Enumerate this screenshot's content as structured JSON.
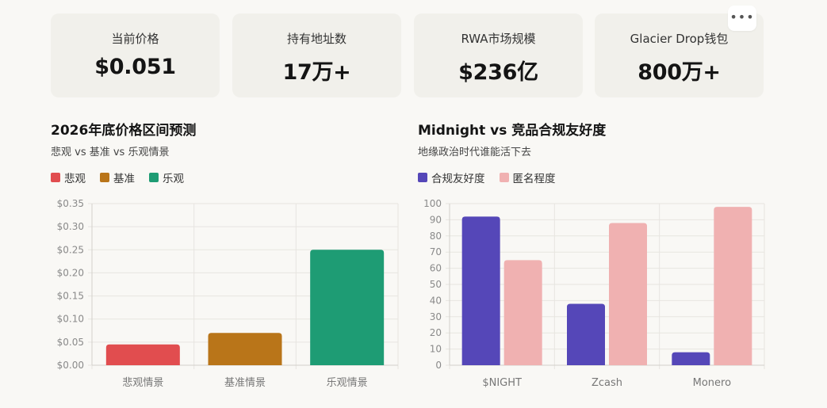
{
  "stats": [
    {
      "label": "当前价格",
      "value": "$0.051"
    },
    {
      "label": "持有地址数",
      "value": "17万+"
    },
    {
      "label": "RWA市场规模",
      "value": "$236亿"
    },
    {
      "label": "Glacier Drop钱包",
      "value": "800万+"
    }
  ],
  "more_button": "•••",
  "chart_data": [
    {
      "type": "bar",
      "title": "2026年底价格区间预测",
      "subtitle": "悲观 vs 基准 vs 乐观情景",
      "legend": [
        "悲观",
        "基准",
        "乐观"
      ],
      "categories": [
        "悲观情景",
        "基准情景",
        "乐观情景"
      ],
      "values": [
        0.045,
        0.07,
        0.25
      ],
      "colors": [
        "#e14d4f",
        "#b97519",
        "#1e9c74"
      ],
      "ylim": [
        0,
        0.35
      ],
      "yticks": [
        "$0.00",
        "$0.05",
        "$0.10",
        "$0.15",
        "$0.20",
        "$0.25",
        "$0.30",
        "$0.35"
      ],
      "grid": true,
      "legend_position": "top-left"
    },
    {
      "type": "bar",
      "title": "Midnight vs 竞品合规友好度",
      "subtitle": "地缘政治时代谁能活下去",
      "categories": [
        "$NIGHT",
        "Zcash",
        "Monero"
      ],
      "series": [
        {
          "name": "合规友好度",
          "values": [
            92,
            38,
            8
          ],
          "color": "#5547b8"
        },
        {
          "name": "匿名程度",
          "values": [
            65,
            88,
            98
          ],
          "color": "#f0b1b1"
        }
      ],
      "ylim": [
        0,
        100
      ],
      "yticks": [
        "0",
        "10",
        "20",
        "30",
        "40",
        "50",
        "60",
        "70",
        "80",
        "90",
        "100"
      ],
      "grid": true,
      "legend_position": "top-left"
    }
  ]
}
